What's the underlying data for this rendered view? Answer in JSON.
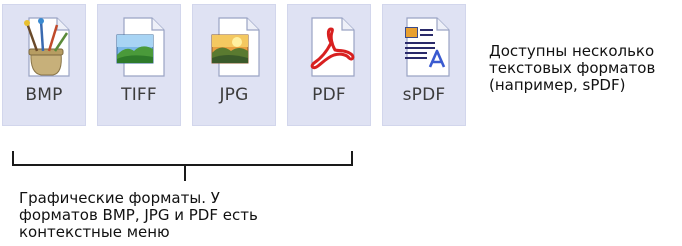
{
  "format_tiles": [
    {
      "label": "BMP",
      "icon": "bmp-file-icon"
    },
    {
      "label": "TIFF",
      "icon": "tiff-file-icon"
    },
    {
      "label": "JPG",
      "icon": "jpg-file-icon"
    },
    {
      "label": "PDF",
      "icon": "pdf-file-icon"
    },
    {
      "label": "sPDF",
      "icon": "spdf-file-icon"
    }
  ],
  "text_formats_note": {
    "lines": [
      "Доступны несколько",
      "текстовых форматов",
      "(например, sPDF)"
    ]
  },
  "image_formats_note": {
    "lines": [
      "Графические форматы. У",
      "форматов BMP, JPG и PDF есть",
      "контекстные меню"
    ]
  },
  "colors": {
    "tile_background": "#dfe2f3",
    "tile_border": "#d2d6ec",
    "label_text": "#3c3c3c",
    "caption_text": "#111111"
  }
}
